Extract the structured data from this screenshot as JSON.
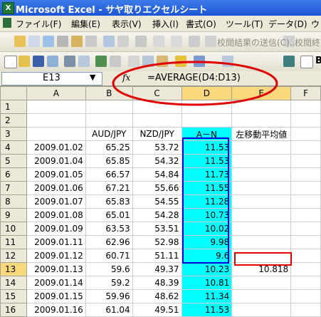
{
  "window": {
    "title": "Microsoft Excel - サヤ取りエクセルシート",
    "app_icon": "X"
  },
  "menu": [
    "ファイル(F)",
    "編集(E)",
    "表示(V)",
    "挿入(I)",
    "書式(O)",
    "ツール(T)",
    "データ(D)",
    "ウ"
  ],
  "toolbar1": {
    "text1": "校閲結果の送信(C)...",
    "text2": "校閲終了"
  },
  "toolbar2": {
    "font_size_label": "B"
  },
  "formula_bar": {
    "name_box": "E13",
    "fx": "fx",
    "formula": "=AVERAGE(D4:D13)"
  },
  "columns": [
    "A",
    "B",
    "C",
    "D",
    "E",
    "F"
  ],
  "rows": [
    {
      "n": "1",
      "a": "",
      "b": "",
      "c": "",
      "d": "",
      "e": ""
    },
    {
      "n": "2",
      "a": "",
      "b": "",
      "c": "",
      "d": "",
      "e": ""
    },
    {
      "n": "3",
      "a": "",
      "b": "AUD/JPY",
      "c": "NZD/JPY",
      "d": "A－N",
      "e": "左移動平均値"
    },
    {
      "n": "4",
      "a": "2009.01.02",
      "b": "65.25",
      "c": "53.72",
      "d": "11.53",
      "e": ""
    },
    {
      "n": "5",
      "a": "2009.01.04",
      "b": "65.85",
      "c": "54.32",
      "d": "11.53",
      "e": ""
    },
    {
      "n": "6",
      "a": "2009.01.05",
      "b": "66.57",
      "c": "54.84",
      "d": "11.73",
      "e": ""
    },
    {
      "n": "7",
      "a": "2009.01.06",
      "b": "67.21",
      "c": "55.66",
      "d": "11.55",
      "e": ""
    },
    {
      "n": "8",
      "a": "2009.01.07",
      "b": "65.83",
      "c": "54.55",
      "d": "11.28",
      "e": ""
    },
    {
      "n": "9",
      "a": "2009.01.08",
      "b": "65.01",
      "c": "54.28",
      "d": "10.73",
      "e": ""
    },
    {
      "n": "10",
      "a": "2009.01.09",
      "b": "63.53",
      "c": "53.51",
      "d": "10.02",
      "e": ""
    },
    {
      "n": "11",
      "a": "2009.01.11",
      "b": "62.96",
      "c": "52.98",
      "d": "9.98",
      "e": ""
    },
    {
      "n": "12",
      "a": "2009.01.12",
      "b": "60.71",
      "c": "51.11",
      "d": "9.6",
      "e": ""
    },
    {
      "n": "13",
      "a": "2009.01.13",
      "b": "59.6",
      "c": "49.37",
      "d": "10.23",
      "e": "10.818"
    },
    {
      "n": "14",
      "a": "2009.01.14",
      "b": "59.2",
      "c": "48.39",
      "d": "10.81",
      "e": ""
    },
    {
      "n": "15",
      "a": "2009.01.15",
      "b": "59.96",
      "c": "48.62",
      "d": "11.34",
      "e": ""
    },
    {
      "n": "16",
      "a": "2009.01.16",
      "b": "61.04",
      "c": "49.51",
      "d": "11.53",
      "e": ""
    }
  ],
  "colors": {
    "highlight": "#00ffff",
    "selection_border": "#0000dd",
    "annotation_red": "#e00000"
  }
}
